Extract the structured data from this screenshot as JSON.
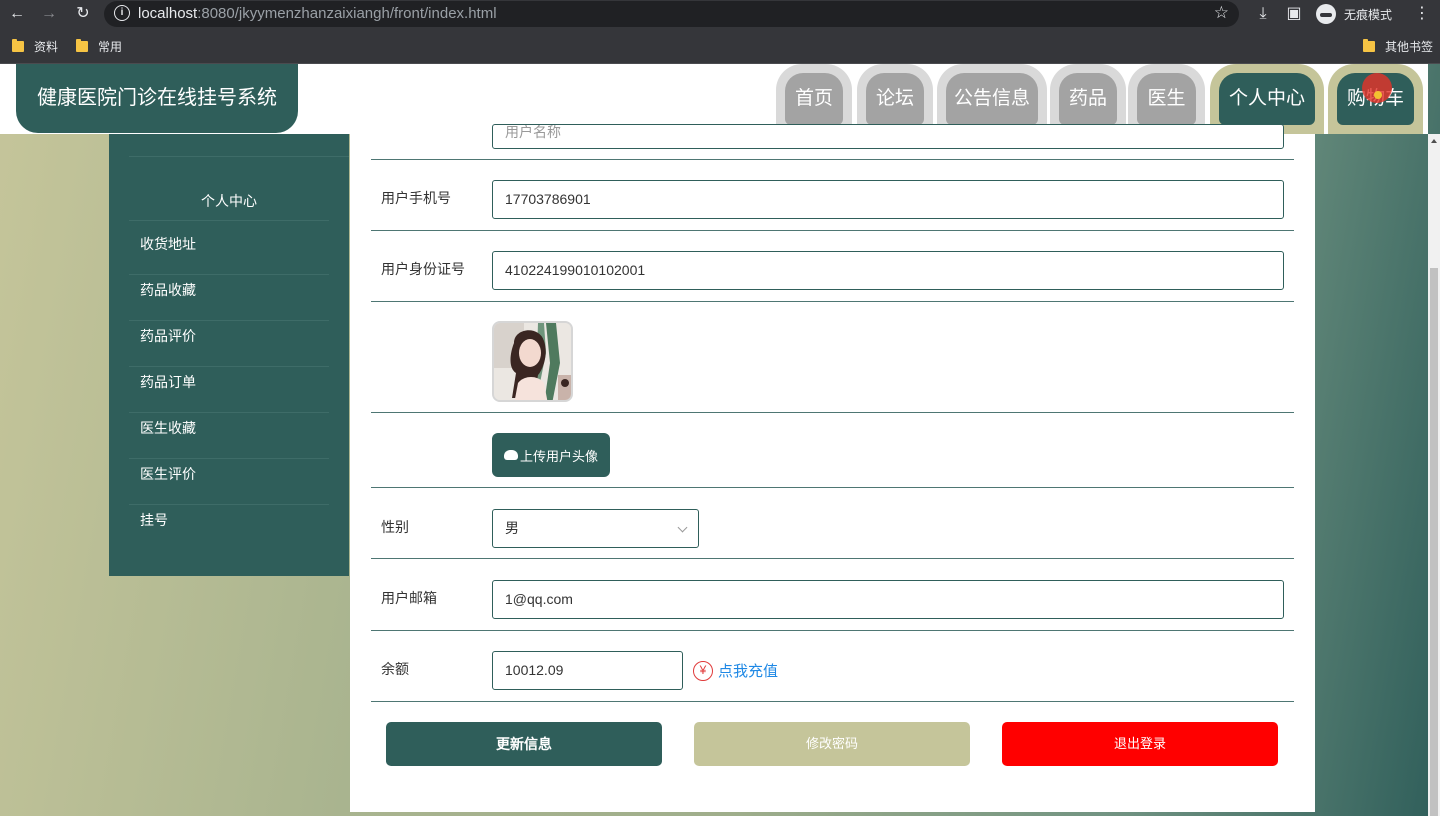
{
  "browser": {
    "url_host": "localhost",
    "url_rest": ":8080/jkyymenzhanzaixiangh/front/index.html",
    "incognito_label": "无痕模式",
    "bookmarks": [
      "资料",
      "常用"
    ],
    "other_bookmarks": "其他书签"
  },
  "site": {
    "title": "健康医院门诊在线挂号系统",
    "nav": [
      "首页",
      "论坛",
      "公告信息",
      "药品",
      "医生",
      "个人中心",
      "购物车"
    ]
  },
  "sidebar": {
    "title": "个人中心",
    "items": [
      "收货地址",
      "药品收藏",
      "药品评价",
      "药品订单",
      "医生收藏",
      "医生评价",
      "挂号"
    ]
  },
  "form": {
    "partial_value": "用户名称",
    "phone_label": "用户手机号",
    "phone_value": "17703786901",
    "idcard_label": "用户身份证号",
    "idcard_value": "410224199010102001",
    "upload_label": "上传用户头像",
    "gender_label": "性别",
    "gender_value": "男",
    "email_label": "用户邮箱",
    "email_value": "1@qq.com",
    "balance_label": "余额",
    "balance_value": "10012.09",
    "recharge_icon": "¥",
    "recharge_text": "点我充值"
  },
  "actions": {
    "update": "更新信息",
    "change_password": "修改密码",
    "logout": "退出登录"
  },
  "colors": {
    "primary": "#2f5e5a",
    "accent": "#c5c59a",
    "danger": "#ff0000",
    "link": "#1e88e5"
  }
}
